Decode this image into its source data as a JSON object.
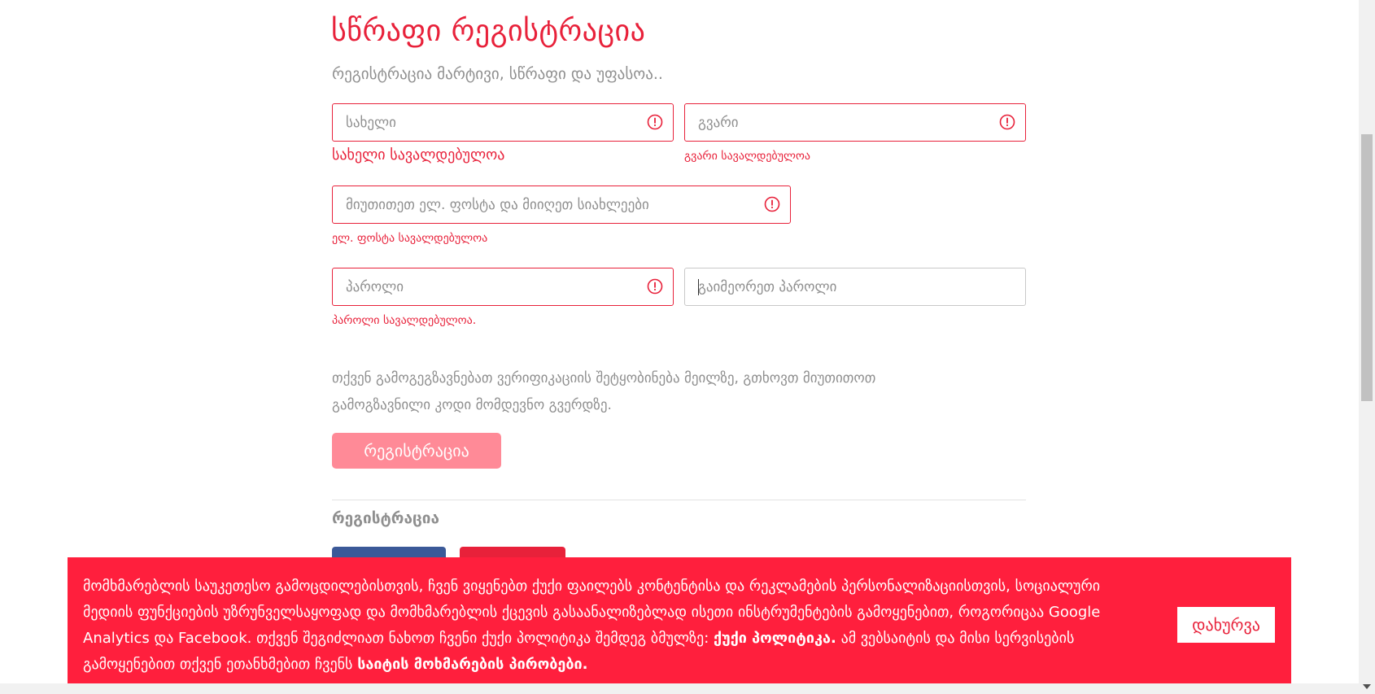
{
  "header": {
    "title": "სწრაფი რეგისტრაცია",
    "subtitle": "რეგისტრაცია მარტივი, სწრაფი და უფასოა.."
  },
  "form": {
    "first_name": {
      "placeholder": "სახელი",
      "value": "",
      "error": "სახელი სავალდებულოა"
    },
    "last_name": {
      "placeholder": "გვარი",
      "value": "",
      "error": "გვარი სავალდებულოა"
    },
    "email": {
      "placeholder": "მიუთითეთ ელ. ფოსტა და მიიღეთ სიახლეები",
      "value": "",
      "error": "ელ. ფოსტა სავალდებულოა"
    },
    "password": {
      "placeholder": "პაროლი",
      "value": "",
      "error": "პაროლი სავალდებულოა."
    },
    "password_repeat": {
      "placeholder": "გაიმეორეთ პაროლი",
      "value": ""
    },
    "info_text": "თქვენ გამოგეგზავნებათ ვერიფიკაციის შეტყობინება მეილზე, გთხოვთ მიუთითოთ გამოგზავნილი კოდი მომდევნო გვერდზე.",
    "submit_label": "რეგისტრაცია"
  },
  "social_section": {
    "title": "რეგისტრაცია"
  },
  "cookie_banner": {
    "text_1": "მომხმარებლის საუკეთესო გამოცდილებისთვის, ჩვენ ვიყენებთ ქუქი ფაილებს კონტენტისა და რეკლამების პერსონალიზაციისთვის, სოციალური მედიის ფუნქციების უზრუნველსაყოფად და მომხმარებლის ქცევის გასაანალიზებლად ისეთი ინსტრუმენტების გამოყენებით, როგორიცაა Google Analytics და Facebook. თქვენ შეგიძლიათ ნახოთ ჩვენი ქუქი პოლიტიკა შემდეგ ბმულზე: ",
    "cookie_policy_link": "ქუქი პოლიტიკა.",
    "text_2": " ამ ვებსაიტის და მისი სერვისების გამოყენებით თქვენ ეთანხმებით ჩვენს ",
    "terms_link": "საიტის მოხმარების პირობები.",
    "close_label": "დახურვა"
  },
  "colors": {
    "accent": "#e8213a",
    "banner": "#ff1f3d",
    "submit_disabled": "#ff8a97",
    "facebook": "#3b5998"
  }
}
